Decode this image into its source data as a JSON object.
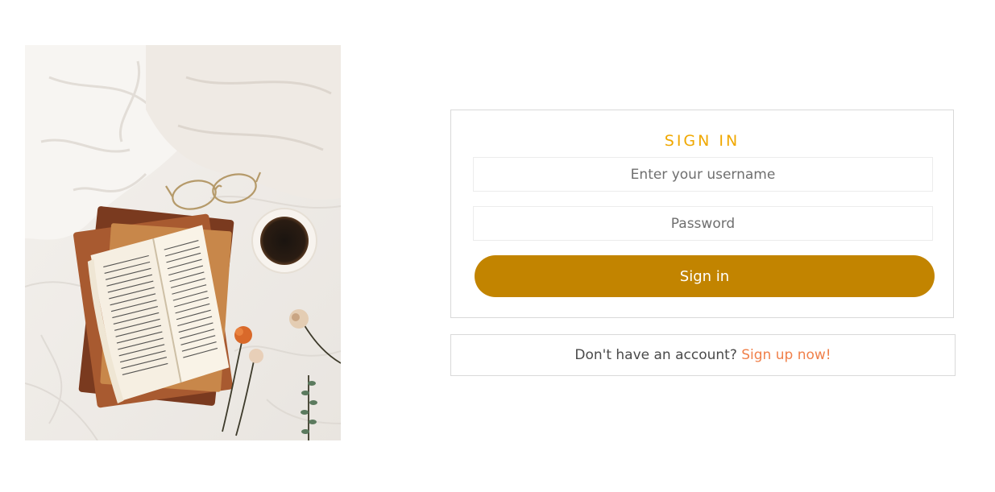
{
  "hero": {
    "alt": "Open book on stacked books with glasses, coffee cup and dried flowers on white linen",
    "book_text_lines": 22
  },
  "signin": {
    "title": "SIGN IN",
    "username_placeholder": "Enter your username",
    "password_placeholder": "Password",
    "button_label": "Sign in"
  },
  "signup": {
    "prompt": "Don't have an account?",
    "link_label": "Sign up now!"
  },
  "colors": {
    "accent_title": "#f0a800",
    "button_bg": "#c28400",
    "link": "#f0804a",
    "border": "#d9d9d9"
  }
}
